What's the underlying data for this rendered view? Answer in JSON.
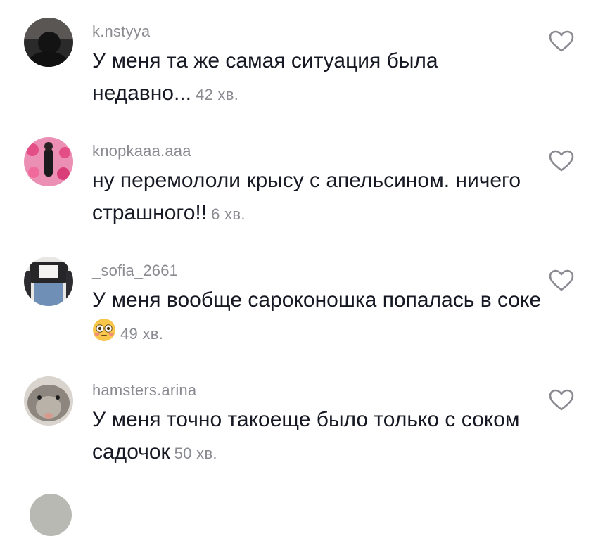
{
  "comments": [
    {
      "username": "k.nstyya",
      "text": "У меня та же самая ситуация была недавно...",
      "time": "42 хв.",
      "avatar_icon": "dark-silhouette-avatar",
      "avatar_color": "#2b2a2a"
    },
    {
      "username": "knopkaaa.aaa",
      "text": "ну перемололи крысу с апельсином. ничего страшного!!",
      "time": "6 хв.",
      "avatar_icon": "pink-hearts-avatar",
      "avatar_color": "#e7689c"
    },
    {
      "username": "_sofia_2661",
      "text": "У меня вообще сароконошка попалась в соке",
      "time": "49 хв.",
      "emoji": "flushed-face-emoji",
      "avatar_icon": "outfit-photo-avatar",
      "avatar_color": "#3a3d44"
    },
    {
      "username": "hamsters.arina",
      "text": "У меня точно такоеще было только с соком садочок",
      "time": "50 хв.",
      "avatar_icon": "hamster-avatar",
      "avatar_color": "#8e8a84"
    }
  ],
  "like_icon": "heart-outline-icon",
  "colors": {
    "text": "#161823",
    "secondary": "#8a8b91",
    "icon": "#8a8b91"
  }
}
